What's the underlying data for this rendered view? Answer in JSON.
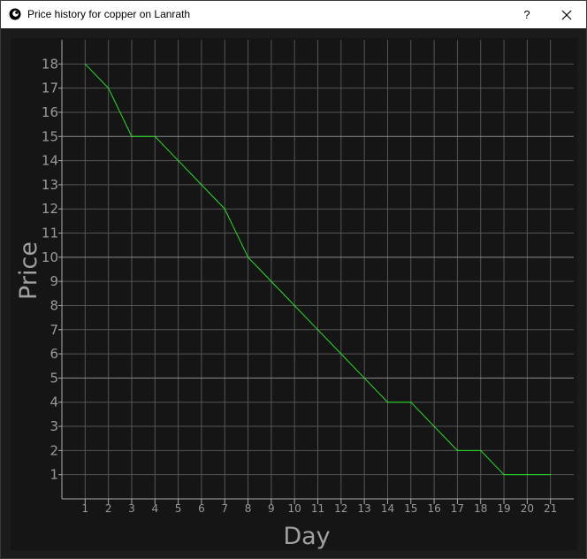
{
  "window": {
    "title": "Price history for copper on Lanrath",
    "help_label": "?",
    "app_icon": "coin-icon",
    "close_icon": "close-icon"
  },
  "chart_data": {
    "type": "line",
    "title": "",
    "xlabel": "Day",
    "ylabel": "Price",
    "x": [
      1,
      2,
      3,
      4,
      5,
      6,
      7,
      8,
      9,
      10,
      11,
      12,
      13,
      14,
      15,
      16,
      17,
      18,
      19,
      20,
      21
    ],
    "series": [
      {
        "values": [
          18,
          17,
          15,
          15,
          14,
          13,
          12,
          10,
          9,
          8,
          7,
          6,
          5,
          4,
          4,
          3,
          2,
          2,
          1,
          1,
          1
        ],
        "color": "#22e022"
      }
    ],
    "xlim": [
      0,
      22
    ],
    "ylim": [
      0,
      19
    ],
    "x_ticks": [
      1,
      2,
      3,
      4,
      5,
      6,
      7,
      8,
      9,
      10,
      11,
      12,
      13,
      14,
      15,
      16,
      17,
      18,
      19,
      20,
      21
    ],
    "y_ticks": [
      1,
      2,
      3,
      4,
      5,
      6,
      7,
      8,
      9,
      10,
      11,
      12,
      13,
      14,
      15,
      16,
      17,
      18
    ],
    "major_y_gridlines": [
      5,
      10,
      15
    ],
    "grid": true,
    "background": "#151515",
    "grid_color": "#555555",
    "major_grid_color": "#8a8a8a",
    "tick_label_color": "#9a9a9a",
    "axis_label_color": "#a0a0a0"
  }
}
